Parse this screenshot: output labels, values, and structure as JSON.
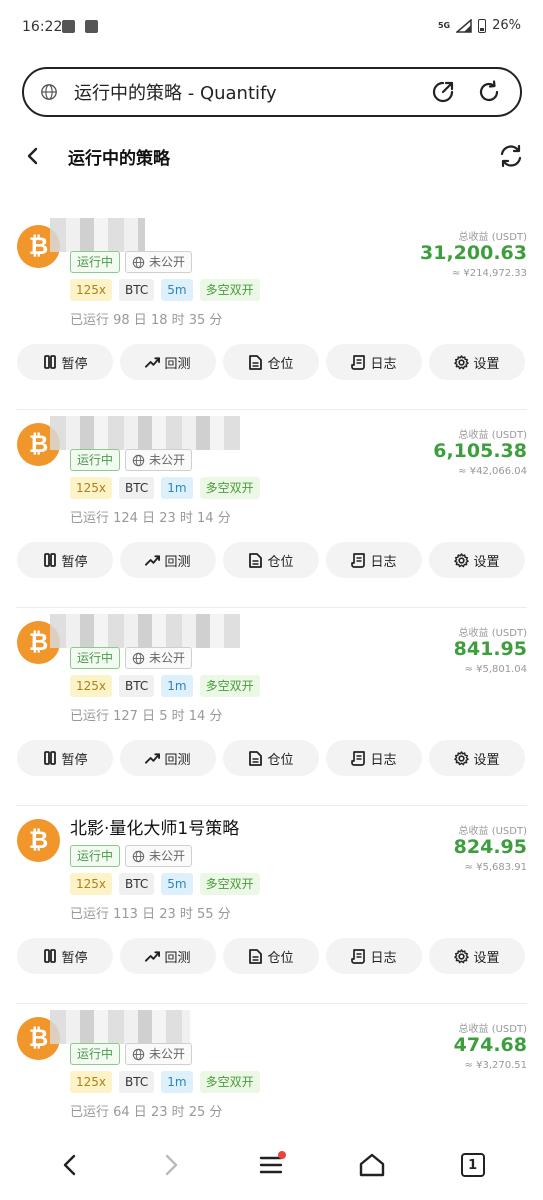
{
  "status_bar": {
    "time": "16:22",
    "network": "5G",
    "battery": "26%"
  },
  "browser": {
    "url_title": "运行中的策略 - Quantify"
  },
  "header": {
    "title": "运行中的策略"
  },
  "labels": {
    "total_profit": "总收益 (USDT)",
    "running": "运行中",
    "private": "未公开",
    "mode": "多空双开"
  },
  "actions": {
    "pause": "暂停",
    "backtest": "回测",
    "position": "仓位",
    "log": "日志",
    "settings": "设置"
  },
  "strategies": [
    {
      "name": "",
      "leverage": "125x",
      "coin": "BTC",
      "timeframe": "5m",
      "run_time": "已运行 98 日 18 时 35 分",
      "profit": "31,200.63",
      "profit_cny": "≈ ¥214,972.33"
    },
    {
      "name": "",
      "leverage": "125x",
      "coin": "BTC",
      "timeframe": "1m",
      "run_time": "已运行 124 日 23 时 14 分",
      "profit": "6,105.38",
      "profit_cny": "≈ ¥42,066.04"
    },
    {
      "name": "",
      "leverage": "125x",
      "coin": "BTC",
      "timeframe": "1m",
      "run_time": "已运行 127 日 5 时 14 分",
      "profit": "841.95",
      "profit_cny": "≈ ¥5,801.04"
    },
    {
      "name": "北影·量化大师1号策略",
      "leverage": "125x",
      "coin": "BTC",
      "timeframe": "5m",
      "run_time": "已运行 113 日 23 时 55 分",
      "profit": "824.95",
      "profit_cny": "≈ ¥5,683.91"
    },
    {
      "name": "",
      "leverage": "125x",
      "coin": "BTC",
      "timeframe": "1m",
      "run_time": "已运行 64 日 23 时 25 分",
      "profit": "474.68",
      "profit_cny": "≈ ¥3,270.51"
    }
  ],
  "nav": {
    "tab_count": "1"
  }
}
